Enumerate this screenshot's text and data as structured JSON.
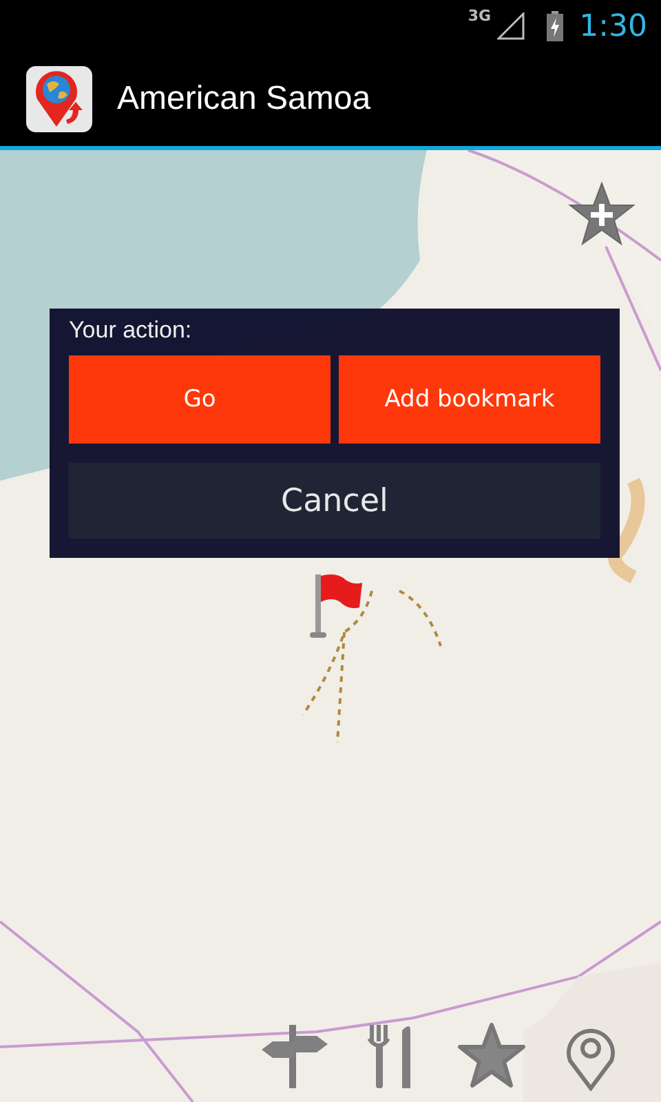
{
  "status_bar": {
    "network": "3G",
    "time": "1:30"
  },
  "action_bar": {
    "title": "American Samoa"
  },
  "dialog": {
    "title": "Your action:",
    "buttons": [
      {
        "label": "Go",
        "kind": "accent"
      },
      {
        "label": "Add bookmark",
        "kind": "accent"
      },
      {
        "label": "Cancel",
        "kind": "plain"
      }
    ]
  }
}
